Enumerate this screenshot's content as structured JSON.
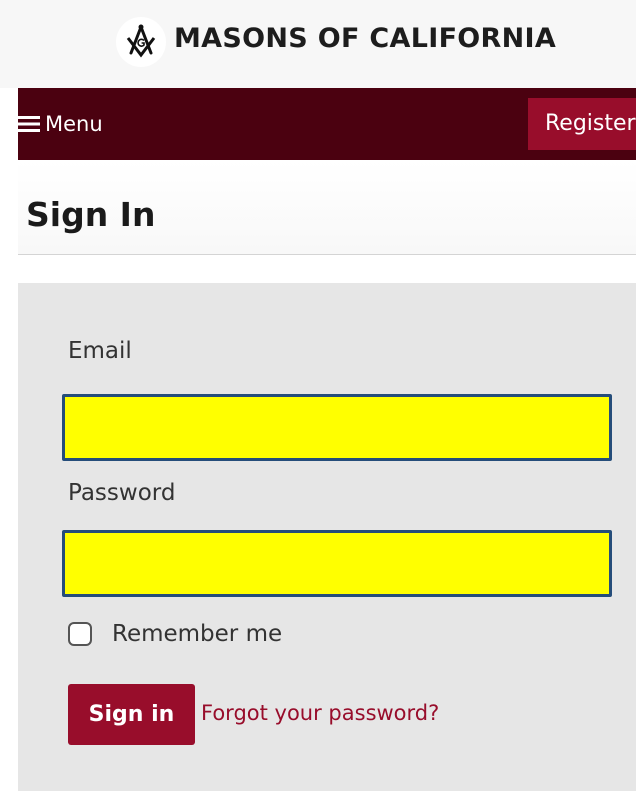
{
  "header": {
    "brand_name": "MASONS OF CALIFORNIA",
    "logo_icon": "square-and-compasses-icon"
  },
  "nav": {
    "menu_icon": "hamburger-menu-icon",
    "menu_label": "Menu",
    "register_label": "Register"
  },
  "page": {
    "title": "Sign In"
  },
  "form": {
    "email": {
      "label": "Email",
      "value": ""
    },
    "password": {
      "label": "Password",
      "value": ""
    },
    "remember": {
      "label": "Remember me",
      "checked": false
    },
    "submit_label": "Sign in",
    "forgot_label": "Forgot your password?"
  },
  "colors": {
    "brand_bar": "#f7f7f7",
    "nav_background": "#4b0110",
    "accent": "#980d2b",
    "panel_background": "#e6e6e6",
    "field_highlight": "#ffff00",
    "field_border": "#254d7a"
  }
}
